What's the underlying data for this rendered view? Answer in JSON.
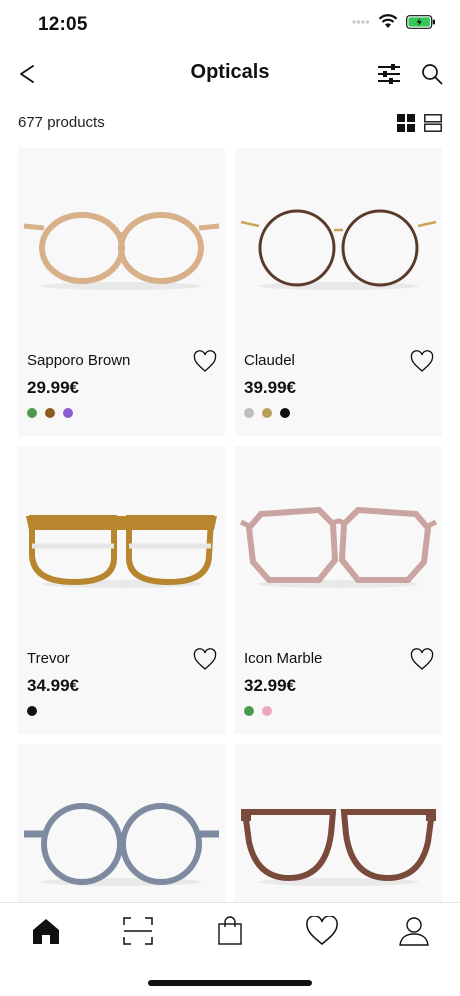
{
  "status_bar": {
    "time": "12:05"
  },
  "header": {
    "title": "Opticals"
  },
  "listing": {
    "product_count": "677 products"
  },
  "products": [
    {
      "name": "Sapporo Brown",
      "price": "29.99€",
      "frame_color": "#d8b08a",
      "swatches": [
        "#4f9a4f",
        "#8a5a1e",
        "#8c5ad0"
      ]
    },
    {
      "name": "Claudel",
      "price": "39.99€",
      "frame_color": "#5a3a2a",
      "swatches": [
        "#bdbdbd",
        "#b8a25a",
        "#111111"
      ]
    },
    {
      "name": "Trevor",
      "price": "34.99€",
      "frame_color": "#b8862e",
      "swatches": [
        "#111111"
      ]
    },
    {
      "name": "Icon Marble",
      "price": "32.99€",
      "frame_color": "#c9a4a0",
      "swatches": [
        "#4a9a4a",
        "#e8a8bc"
      ]
    },
    {
      "name": "",
      "price": "",
      "frame_color": "#7d8aa0",
      "swatches": []
    },
    {
      "name": "",
      "price": "",
      "frame_color": "#7a4a3a",
      "swatches": []
    }
  ],
  "bottom_nav": {
    "items": [
      {
        "icon": "home-icon",
        "active": true
      },
      {
        "icon": "scan-icon",
        "active": false
      },
      {
        "icon": "bag-icon",
        "active": false
      },
      {
        "icon": "heart-icon",
        "active": false
      },
      {
        "icon": "profile-icon",
        "active": false
      }
    ]
  }
}
